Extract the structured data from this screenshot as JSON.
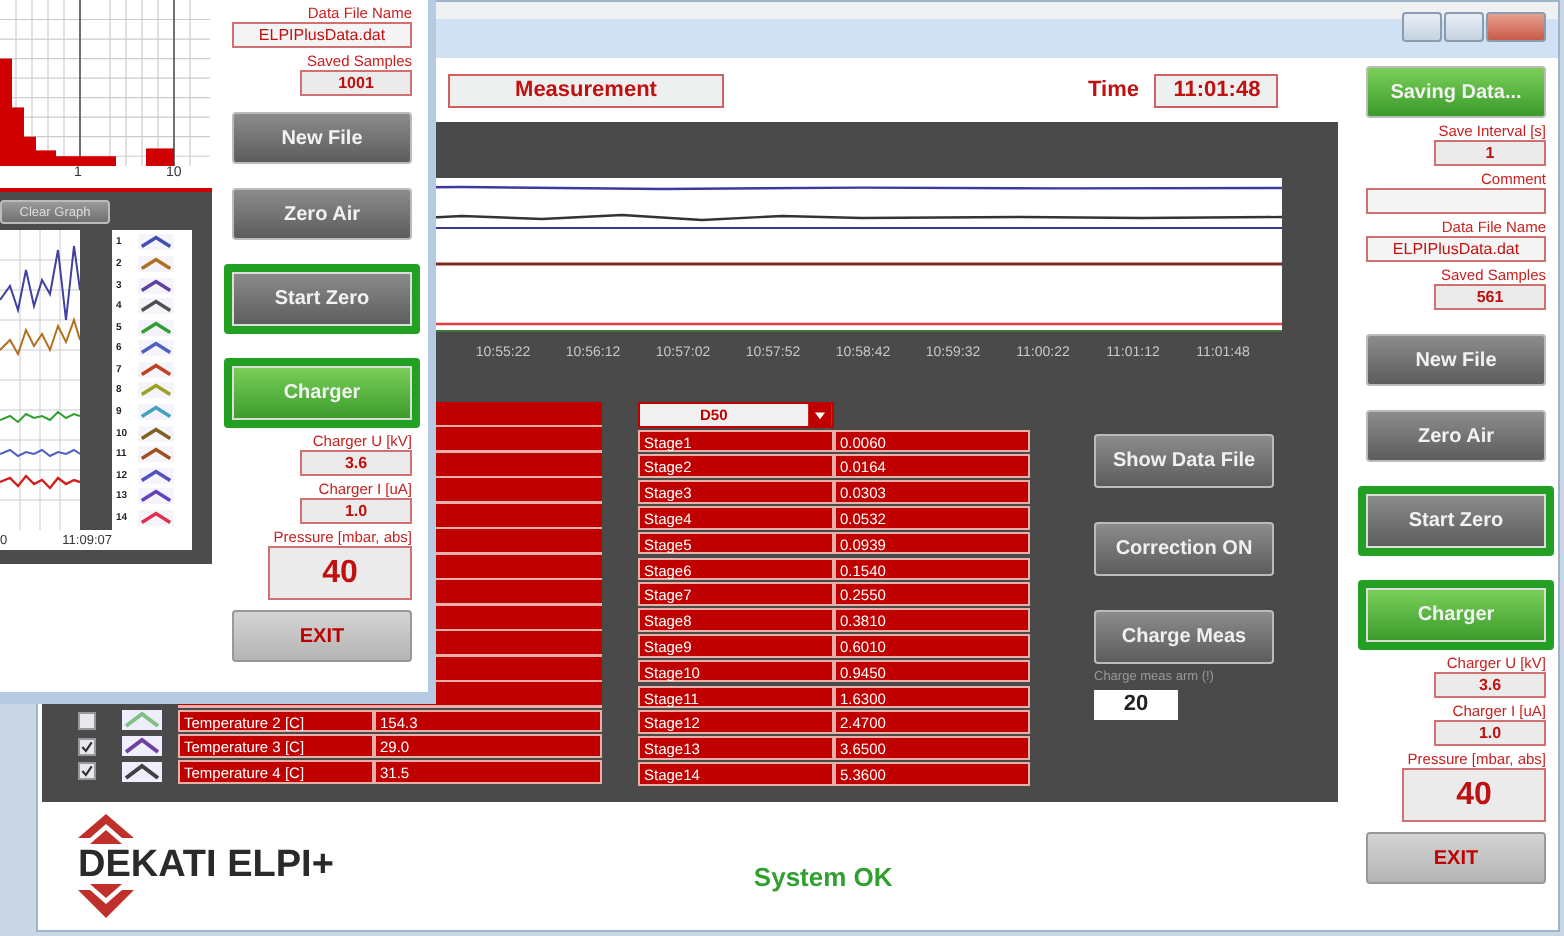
{
  "main_window": {
    "header": {
      "mode": "Measurement",
      "time_label": "Time",
      "time": "11:01:48"
    },
    "trend_chart": {
      "x_ticks": [
        "10:55:22",
        "10:56:12",
        "10:57:02",
        "10:57:52",
        "10:58:42",
        "10:59:32",
        "11:00:22",
        "11:01:12",
        "11:01:48"
      ]
    },
    "sensor_rows": [
      {
        "checked": false,
        "color": "#80c080",
        "name": "Temperature 2 [C]",
        "value": "154.3"
      },
      {
        "checked": true,
        "color": "#7040a0",
        "name": "Temperature 3 [C]",
        "value": "29.0"
      },
      {
        "checked": true,
        "color": "#404040",
        "name": "Temperature 4 [C]",
        "value": "31.5"
      }
    ],
    "stage_table": {
      "selector": "D50",
      "rows": [
        {
          "stage": "Stage1",
          "value": "0.0060"
        },
        {
          "stage": "Stage2",
          "value": "0.0164"
        },
        {
          "stage": "Stage3",
          "value": "0.0303"
        },
        {
          "stage": "Stage4",
          "value": "0.0532"
        },
        {
          "stage": "Stage5",
          "value": "0.0939"
        },
        {
          "stage": "Stage6",
          "value": "0.1540"
        },
        {
          "stage": "Stage7",
          "value": "0.2550"
        },
        {
          "stage": "Stage8",
          "value": "0.3810"
        },
        {
          "stage": "Stage9",
          "value": "0.6010"
        },
        {
          "stage": "Stage10",
          "value": "0.9450"
        },
        {
          "stage": "Stage11",
          "value": "1.6300"
        },
        {
          "stage": "Stage12",
          "value": "2.4700"
        },
        {
          "stage": "Stage13",
          "value": "3.6500"
        },
        {
          "stage": "Stage14",
          "value": "5.3600"
        }
      ]
    },
    "action_buttons": [
      "Show Data File",
      "Correction ON",
      "Charge Meas"
    ],
    "charge_field": {
      "label": "Charge meas arm (!)",
      "value": "20"
    },
    "footer": {
      "logo": "DEKATI ELPI+",
      "status": "System OK"
    },
    "side_panel": [
      {
        "kind": "button",
        "label": "Saving Data...",
        "lit": true,
        "framed": false
      },
      {
        "kind": "field",
        "label": "Save Interval [s]",
        "value": "1"
      },
      {
        "kind": "wide-field",
        "label": "Comment"
      },
      {
        "kind": "wide-field",
        "label": "Data File Name",
        "value": "ELPIPlusData.dat"
      },
      {
        "kind": "field",
        "label": "Saved Samples",
        "value": "561"
      },
      {
        "kind": "button",
        "label": "New File",
        "lit": false,
        "framed": false
      },
      {
        "kind": "button",
        "label": "Zero Air",
        "lit": false,
        "framed": false
      },
      {
        "kind": "button",
        "label": "Start Zero",
        "lit": false,
        "framed": true
      },
      {
        "kind": "button",
        "label": "Charger",
        "lit": true,
        "framed": true
      },
      {
        "kind": "field",
        "label": "Charger U [kV]",
        "value": "3.6"
      },
      {
        "kind": "field",
        "label": "Charger I [uA]",
        "value": "1.0"
      },
      {
        "kind": "big-field",
        "label": "Pressure [mbar, abs]",
        "value": "40"
      },
      {
        "kind": "exit-button",
        "label": "EXIT"
      }
    ]
  },
  "front_window": {
    "histogram": {
      "x_ticks": [
        "1",
        "10"
      ]
    },
    "clear_button": "Clear Graph",
    "trend_chart": {
      "x_ticks": [
        "0",
        "11:09:07"
      ]
    },
    "legend": [
      {
        "label": "1",
        "color": "#4050b0"
      },
      {
        "label": "2",
        "color": "#b07020"
      },
      {
        "label": "3",
        "color": "#6040a0"
      },
      {
        "label": "4",
        "color": "#505050"
      },
      {
        "label": "5",
        "color": "#30a030"
      },
      {
        "label": "6",
        "color": "#5060c0"
      },
      {
        "label": "7",
        "color": "#c04020"
      },
      {
        "label": "8",
        "color": "#a0a020"
      },
      {
        "label": "9",
        "color": "#40a0c0"
      },
      {
        "label": "10",
        "color": "#806020"
      },
      {
        "label": "11",
        "color": "#a05020"
      },
      {
        "label": "12",
        "color": "#5050c0"
      },
      {
        "label": "13",
        "color": "#6040c0"
      },
      {
        "label": "14",
        "color": "#e03050"
      }
    ],
    "side_panel": [
      {
        "kind": "wide-field",
        "label": "Data File Name",
        "value": "ELPIPlusData.dat"
      },
      {
        "kind": "field",
        "label": "Saved Samples",
        "value": "1001"
      },
      {
        "kind": "button",
        "label": "New File",
        "lit": false,
        "framed": false
      },
      {
        "kind": "button",
        "label": "Zero Air",
        "lit": false,
        "framed": false
      },
      {
        "kind": "button",
        "label": "Start Zero",
        "lit": false,
        "framed": true
      },
      {
        "kind": "button",
        "label": "Charger",
        "lit": true,
        "framed": true
      },
      {
        "kind": "field",
        "label": "Charger U [kV]",
        "value": "3.6"
      },
      {
        "kind": "field",
        "label": "Charger I [uA]",
        "value": "1.0"
      },
      {
        "kind": "big-field",
        "label": "Pressure [mbar, abs]",
        "value": "40"
      },
      {
        "kind": "exit-button",
        "label": "EXIT"
      }
    ]
  }
}
